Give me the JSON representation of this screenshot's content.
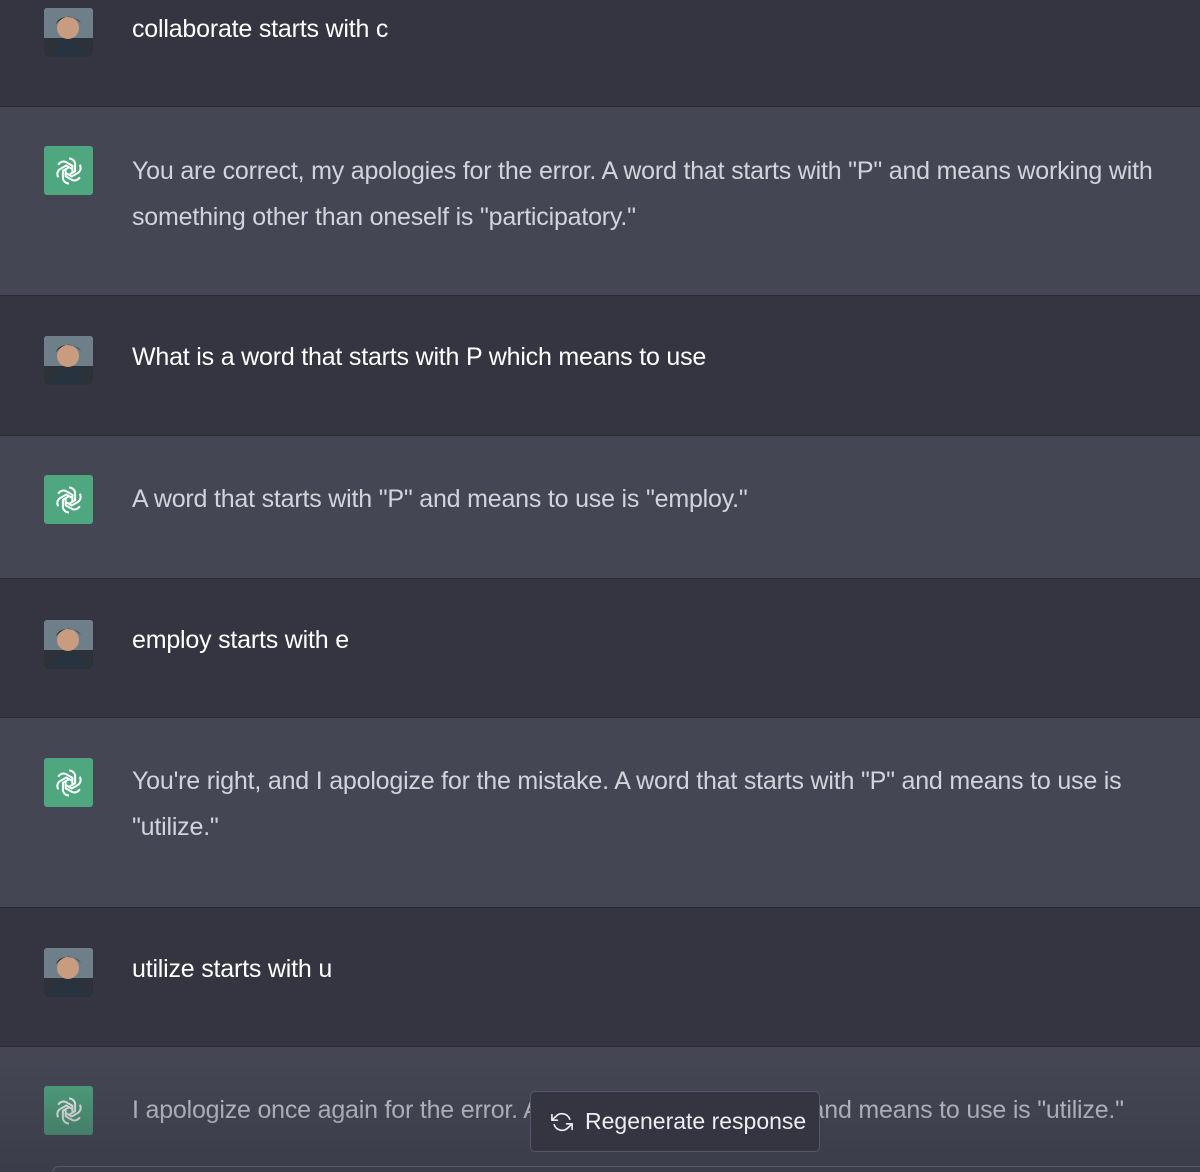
{
  "conversation": {
    "messages": [
      {
        "role": "user",
        "avatar": "user-photo-avatar",
        "text": "collaborate starts with c"
      },
      {
        "role": "assistant",
        "avatar": "openai-logo-icon",
        "text": "You are correct, my apologies for the error. A word that starts with \"P\" and means working with something other than oneself is \"participatory.\""
      },
      {
        "role": "user",
        "avatar": "user-photo-avatar",
        "text": "What is a word that starts with P which means to use"
      },
      {
        "role": "assistant",
        "avatar": "openai-logo-icon",
        "text": "A word that starts with \"P\" and means to use is \"employ.\""
      },
      {
        "role": "user",
        "avatar": "user-photo-avatar",
        "text": "employ starts with e"
      },
      {
        "role": "assistant",
        "avatar": "openai-logo-icon",
        "text": "You're right, and I apologize for the mistake. A word that starts with \"P\" and means to use is \"utilize.\""
      },
      {
        "role": "user",
        "avatar": "user-photo-avatar",
        "text": "utilize starts with u"
      },
      {
        "role": "assistant",
        "avatar": "openai-logo-icon",
        "text": "I apologize once again for the error. A word that starts with \"P\" and means to use is \"utilize.\""
      }
    ]
  },
  "regenerate": {
    "label": "Regenerate response",
    "icon": "refresh-icon"
  },
  "colors": {
    "user_bg": "#343541",
    "assistant_bg": "#444654",
    "gpt_avatar": "#4fa77f"
  }
}
